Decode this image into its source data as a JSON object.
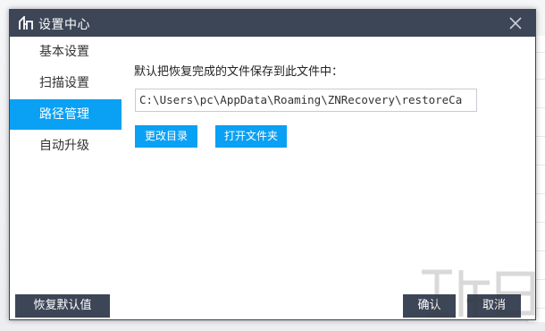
{
  "dialog": {
    "title": "设置中心"
  },
  "sidebar": {
    "items": [
      {
        "label": "基本设置",
        "active": false
      },
      {
        "label": "扫描设置",
        "active": false
      },
      {
        "label": "路径管理",
        "active": true
      },
      {
        "label": "自动升级",
        "active": false
      }
    ]
  },
  "content": {
    "label": "默认把恢复完成的文件保存到此文件中：",
    "path_value": "C:\\Users\\pc\\AppData\\Roaming\\ZNRecovery\\restoreCa",
    "change_dir_label": "更改目录",
    "open_folder_label": "打开文件夹"
  },
  "footer": {
    "restore_default_label": "恢复默认值",
    "ok_label": "确认",
    "cancel_label": "取消"
  },
  "colors": {
    "titlebar": "#3d4657",
    "accent": "#0aa1f4"
  },
  "icons": {
    "logo": "app-logo-icon",
    "close": "close-icon"
  }
}
